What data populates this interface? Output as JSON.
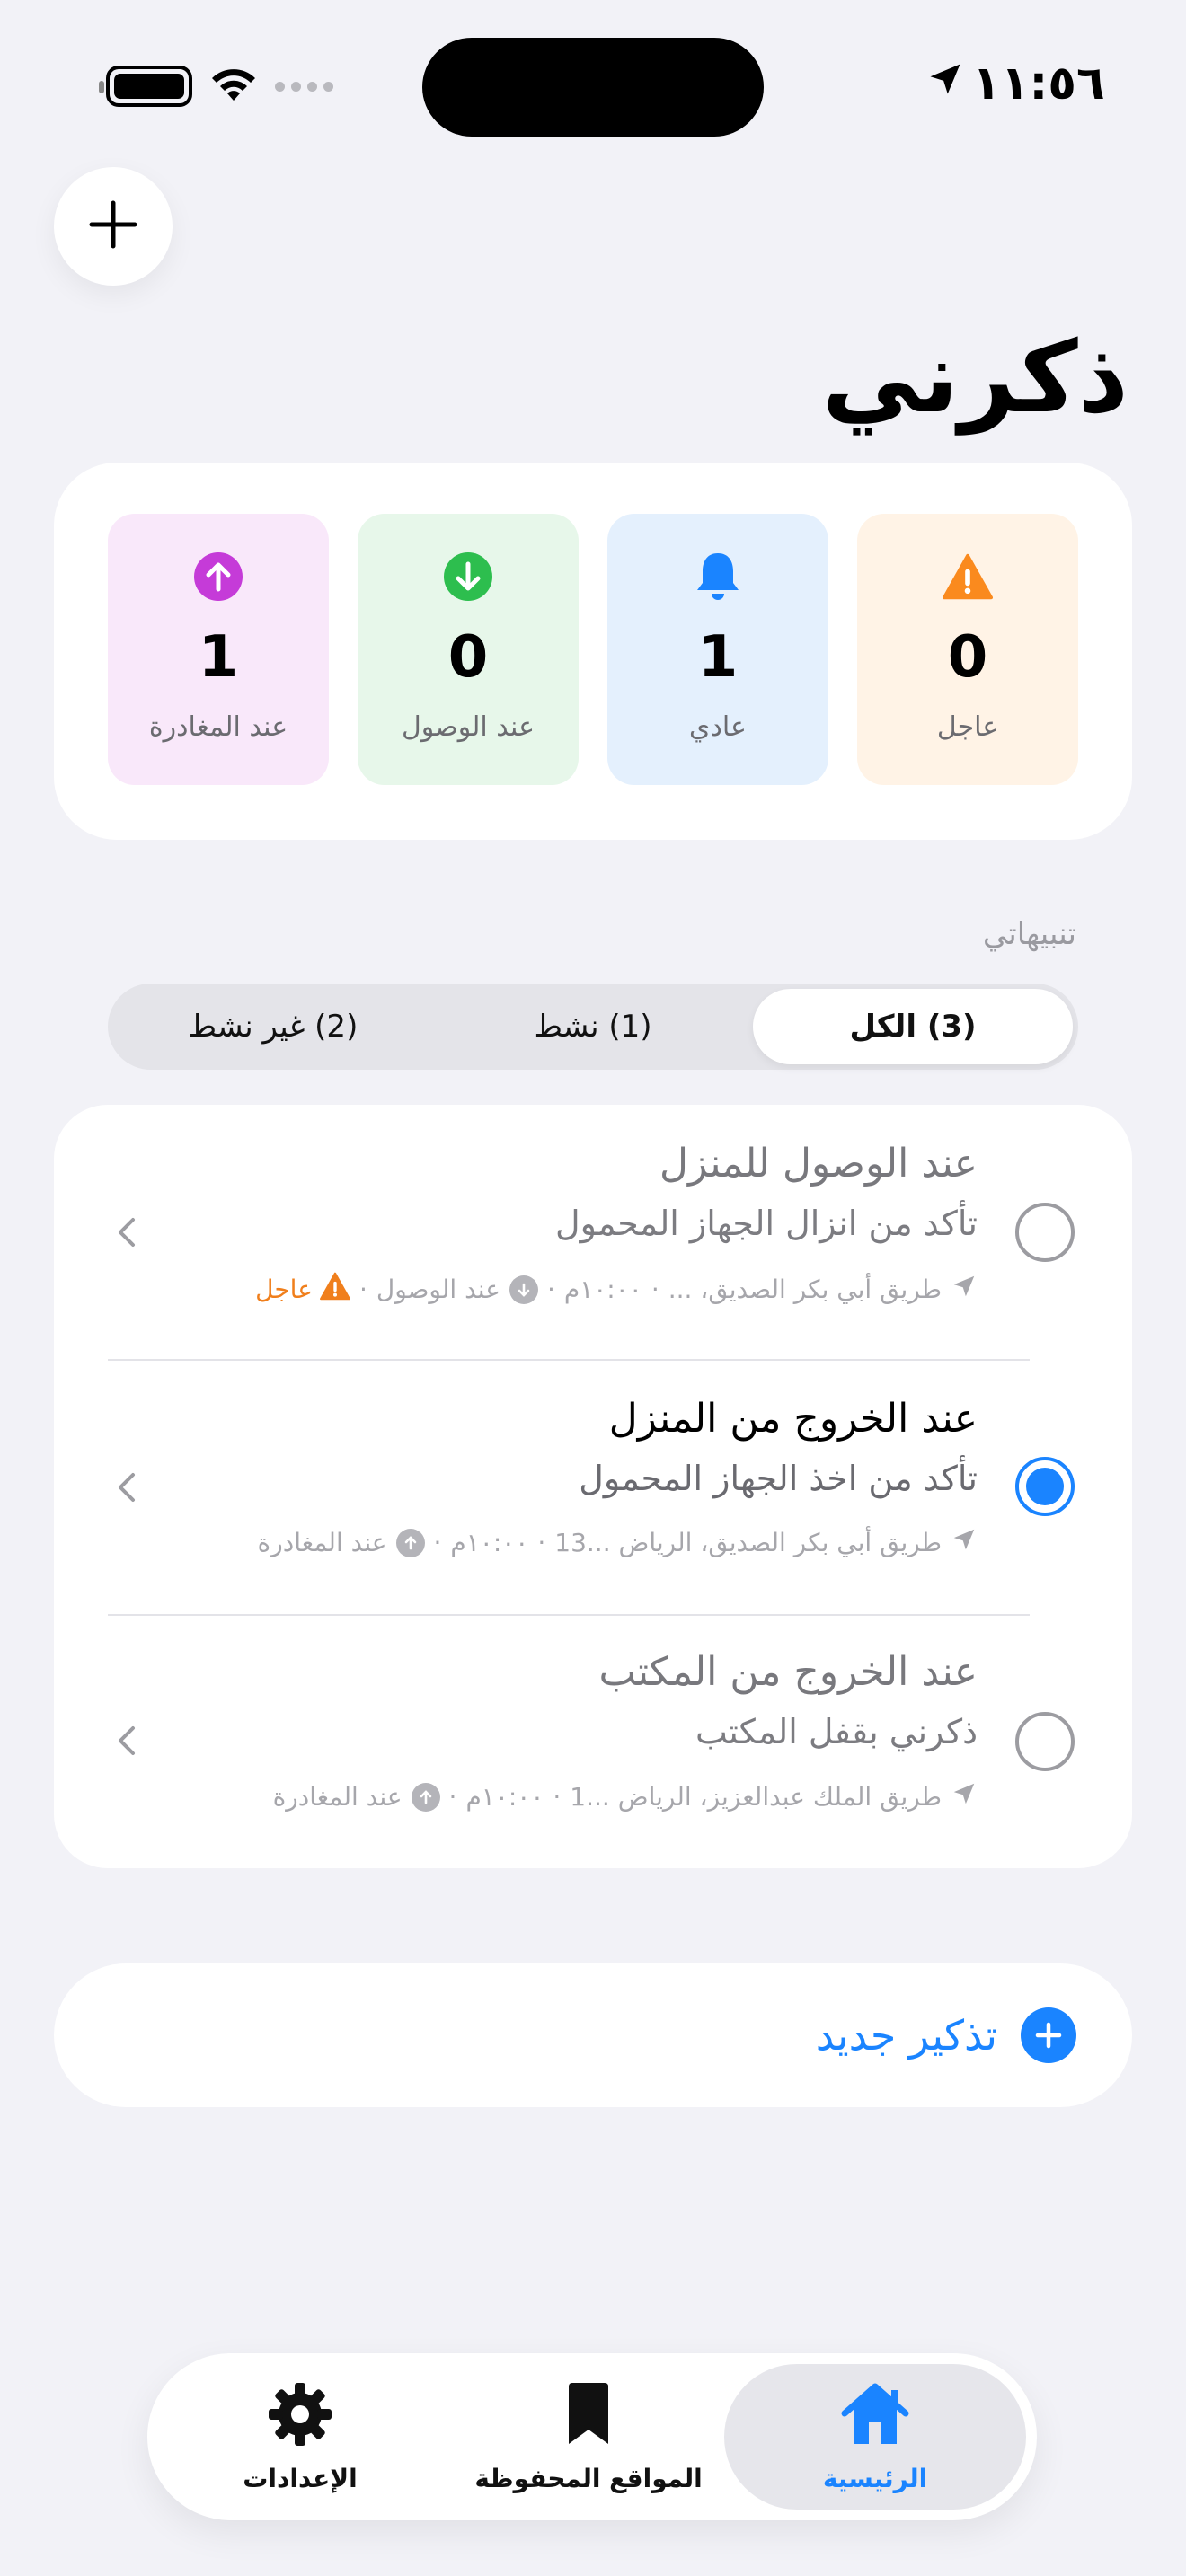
{
  "status_bar": {
    "time": "١١:٥٦"
  },
  "title": "ذكرني",
  "stats": [
    {
      "label": "عاجل",
      "value": "0",
      "icon": "warning-icon",
      "color": "#FA8A1E",
      "bg": "#FFF3E6"
    },
    {
      "label": "عادي",
      "value": "1",
      "icon": "bell-icon",
      "color": "#1A84FF",
      "bg": "#E4F0FD"
    },
    {
      "label": "عند الوصول",
      "value": "0",
      "icon": "arrow-down-circle-icon",
      "color": "#2DBE4E",
      "bg": "#E7F7EA"
    },
    {
      "label": "عند المغادرة",
      "value": "1",
      "icon": "arrow-up-circle-icon",
      "color": "#C53BD8",
      "bg": "#F9E8FA"
    }
  ],
  "section_label": "تنبيهاتي",
  "filters": [
    {
      "label": "(3) الكل",
      "active": true
    },
    {
      "label": "(1) نشط",
      "active": false
    },
    {
      "label": "(2) غير نشط",
      "active": false
    }
  ],
  "reminders": [
    {
      "title": "عند الوصول للمنزل",
      "subtitle": "تأكد من انزال الجهاز المحمول",
      "location": "طريق أبي بكر الصديق، ...",
      "time": "١٠:٠٠م",
      "trigger": "عند الوصول",
      "trigger_icon": "arrow-down-circle-icon",
      "urgent_label": "عاجل",
      "active": false
    },
    {
      "title": "عند الخروج من المنزل",
      "subtitle": "تأكد من اخذ الجهاز المحمول",
      "location": "طريق أبي بكر الصديق، الرياض ...13",
      "time": "١٠:٠٠م",
      "trigger": "عند المغادرة",
      "trigger_icon": "arrow-up-circle-icon",
      "active": true
    },
    {
      "title": "عند الخروج من المكتب",
      "subtitle": "ذكرني بقفل المكتب",
      "location": "طريق الملك عبدالعزيز، الرياض ...1",
      "time": "١٠:٠٠م",
      "trigger": "عند المغادرة",
      "trigger_icon": "arrow-up-circle-icon",
      "active": false
    }
  ],
  "new_reminder_label": "تذكير جديد",
  "tabs": [
    {
      "label": "الرئيسية",
      "icon": "house-icon",
      "active": true
    },
    {
      "label": "المواقع المحفوظة",
      "icon": "bookmark-icon",
      "active": false
    },
    {
      "label": "الإعدادات",
      "icon": "gear-icon",
      "active": false
    }
  ],
  "colors": {
    "accent": "#1A84FF",
    "background": "#F2F2F7",
    "urgent": "#F07F1C"
  }
}
